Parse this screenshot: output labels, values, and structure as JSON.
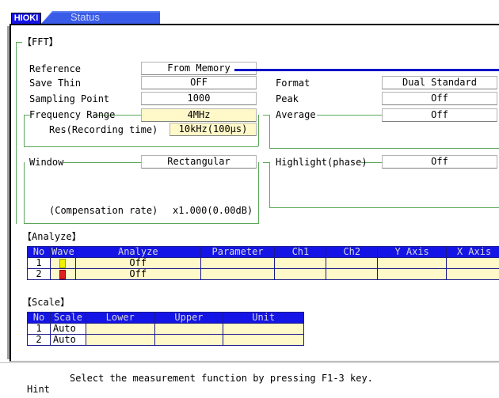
{
  "app": {
    "logo": "HIOKI",
    "tab": "Status"
  },
  "fft": {
    "heading": "【FFT】",
    "reference_label": "Reference",
    "reference_value": "From Memory",
    "save_thin_label": "Save Thin",
    "save_thin_value": "OFF",
    "sampling_point_label": "Sampling Point",
    "sampling_point_value": "1000",
    "frequency_range_label": "Frequency Range",
    "frequency_range_value": "4MHz",
    "res_label": "Res(Recording time)",
    "res_value": "10kHz(100μs)",
    "window_label": "Window",
    "window_value": "Rectangular",
    "compensation_label": "(Compensation rate)",
    "compensation_value": "x1.000(0.00dB)",
    "format_label": "Format",
    "format_value": "Dual Standard",
    "peak_label": "Peak",
    "peak_value": "Off",
    "average_label": "Average",
    "average_value": "Off",
    "highlight_label": "Highlight(phase)",
    "highlight_value": "Off"
  },
  "analyze": {
    "heading": "【Analyze】",
    "columns": [
      "No",
      "Wave",
      "Analyze",
      "Parameter",
      "Ch1",
      "Ch2",
      "Y Axis",
      "X Axis"
    ],
    "rows": [
      {
        "no": "1",
        "wave_color": "#f0f000",
        "analyze": "Off"
      },
      {
        "no": "2",
        "wave_color": "#e02020",
        "analyze": "Off"
      }
    ]
  },
  "scale": {
    "heading": "【Scale】",
    "columns": [
      "No",
      "Scale",
      "Lower",
      "Upper",
      "Unit"
    ],
    "rows": [
      {
        "no": "1",
        "scale": "Auto"
      },
      {
        "no": "2",
        "scale": "Auto"
      }
    ]
  },
  "hint": {
    "label": "Hint",
    "text": "Select the measurement function by pressing F1-3 key."
  },
  "colors": {
    "header_blue": "#1414e6",
    "frame_green": "#5aa85a",
    "field_yellow": "#fff8c8",
    "reference_line": "#0000c8"
  }
}
